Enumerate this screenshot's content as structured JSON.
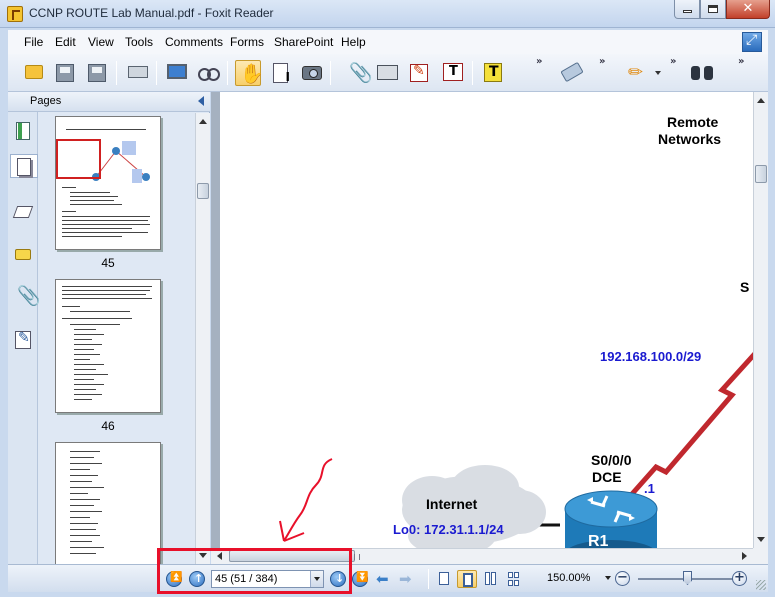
{
  "window": {
    "title": "CCNP ROUTE Lab Manual.pdf - Foxit Reader"
  },
  "menu": {
    "items": [
      "File",
      "Edit",
      "View",
      "Tools",
      "Comments",
      "Forms",
      "SharePoint",
      "Help"
    ]
  },
  "toolbar": {
    "buttons": [
      "open-folder-icon",
      "save-icon",
      "save-as-icon",
      "print-icon",
      "full-screen-icon",
      "read-mode-icon",
      "hand-tool-icon",
      "select-text-icon",
      "snapshot-icon",
      "attach-file-icon",
      "typewriter-icon",
      "pencil-note-icon",
      "text-box-icon",
      "highlight-text-icon",
      "eraser-icon",
      "pencil-icon",
      "find-binoculars-icon"
    ],
    "active_tool": "hand-tool-icon",
    "overflow_glyph": "»"
  },
  "left_panel": {
    "title": "Pages",
    "side_icons": [
      "bookmarks-icon",
      "pages-icon",
      "layers-icon",
      "comments-icon",
      "attachments-icon",
      "signatures-icon"
    ],
    "selected_side_icon": "pages-icon",
    "thumbnails": [
      {
        "page_label": "45"
      },
      {
        "page_label": "46"
      },
      {
        "page_label": ""
      }
    ]
  },
  "document": {
    "labels": {
      "remote_networks_line1": "Remote",
      "remote_networks_line2": "Networks",
      "partial_label": "S",
      "subnet": "192.168.100.0/29",
      "iface_line1": "S0/0/0",
      "iface_line2": "DCE",
      "iface_addr": ".1",
      "cloud_title": "Internet",
      "loopback": "Lo0:  172.31.1.1/24",
      "router_name": "R1"
    },
    "colors": {
      "link_red": "#c0282e",
      "address_blue": "#1a1ad0",
      "router_blue": "#1e7ab8",
      "cloud_fill": "#d9dde3"
    }
  },
  "statusbar": {
    "page_field_value": "45 (51 / 384)",
    "zoom_value": "150.00%",
    "zoom_level_percent": 150,
    "nav_buttons": [
      "first-page-icon",
      "previous-page-icon",
      "next-page-icon",
      "last-page-icon",
      "back-view-icon",
      "forward-view-icon"
    ],
    "layout_buttons": [
      "single-page-icon",
      "continuous-icon",
      "facing-icon",
      "continuous-facing-icon"
    ],
    "active_layout": "continuous-icon",
    "zoom_out": "−",
    "zoom_in": "+"
  },
  "annotation": {
    "highlight_color": "#e8102a"
  }
}
